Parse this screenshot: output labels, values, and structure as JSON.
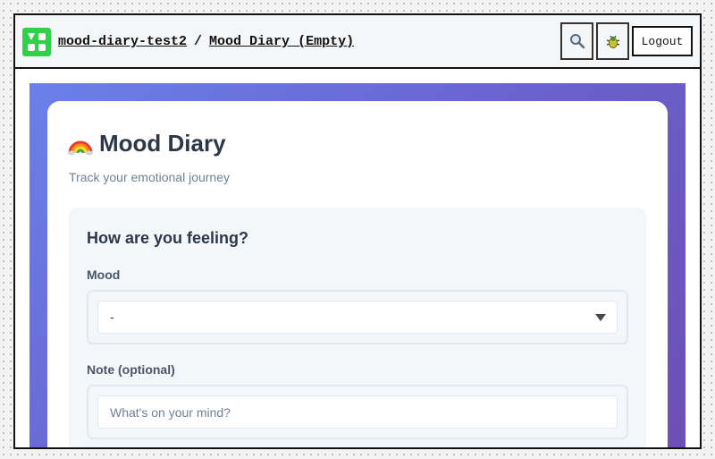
{
  "header": {
    "project": "mood-diary-test2",
    "separator": "/",
    "page": "Mood Diary (Empty)",
    "logout_label": "Logout",
    "search_icon": "magnifier-icon",
    "bug_icon": "bug-icon",
    "logo_color": "#2fd14a"
  },
  "app": {
    "title_emoji": "🌈",
    "title": "Mood Diary",
    "subtitle": "Track your emotional journey",
    "accent_gradient": [
      "#6a80ea",
      "#6d4fb3"
    ]
  },
  "form": {
    "heading": "How are you feeling?",
    "mood_label": "Mood",
    "mood_value": "-",
    "note_label": "Note (optional)",
    "note_placeholder": "What's on your mind?",
    "note_value": ""
  }
}
